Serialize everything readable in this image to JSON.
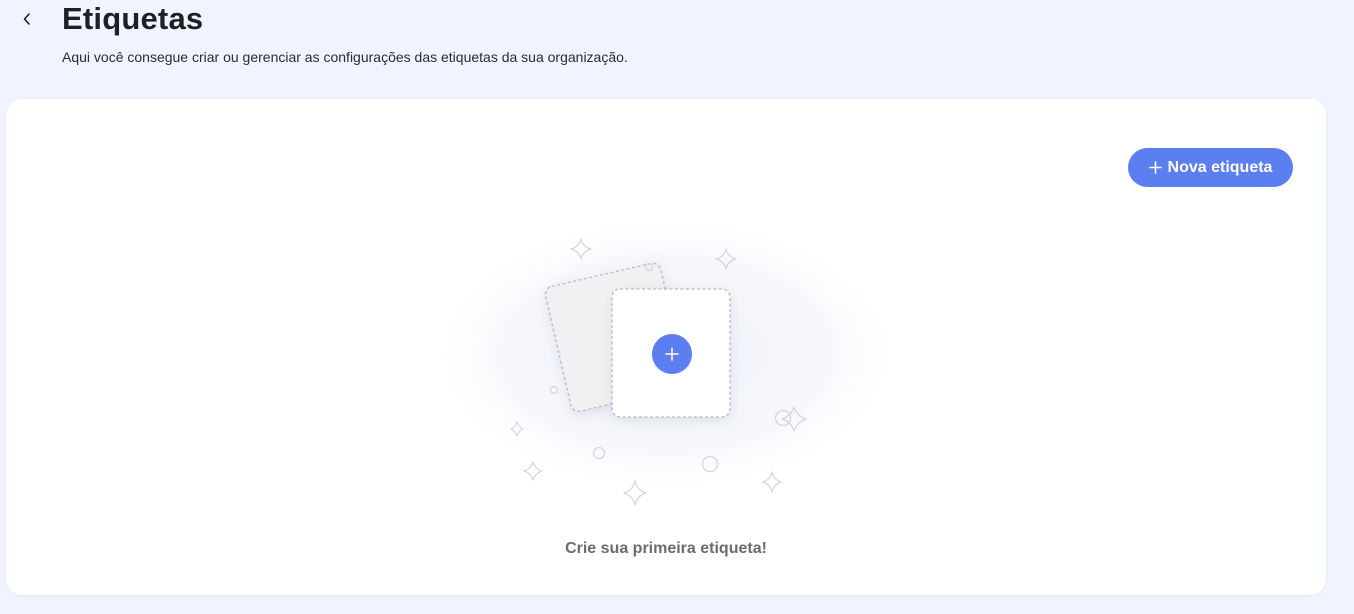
{
  "header": {
    "title": "Etiquetas",
    "subtitle": "Aqui você consegue criar ou gerenciar as configurações das etiquetas da sua organização."
  },
  "toolbar": {
    "new_label_button": "Nova etiqueta"
  },
  "empty_state": {
    "message": "Crie sua primeira etiqueta!"
  },
  "colors": {
    "accent": "#5b7ef0",
    "background": "#eff4fe",
    "card": "#ffffff"
  },
  "icons": {
    "back": "chevron-left-icon",
    "add": "plus-icon"
  }
}
